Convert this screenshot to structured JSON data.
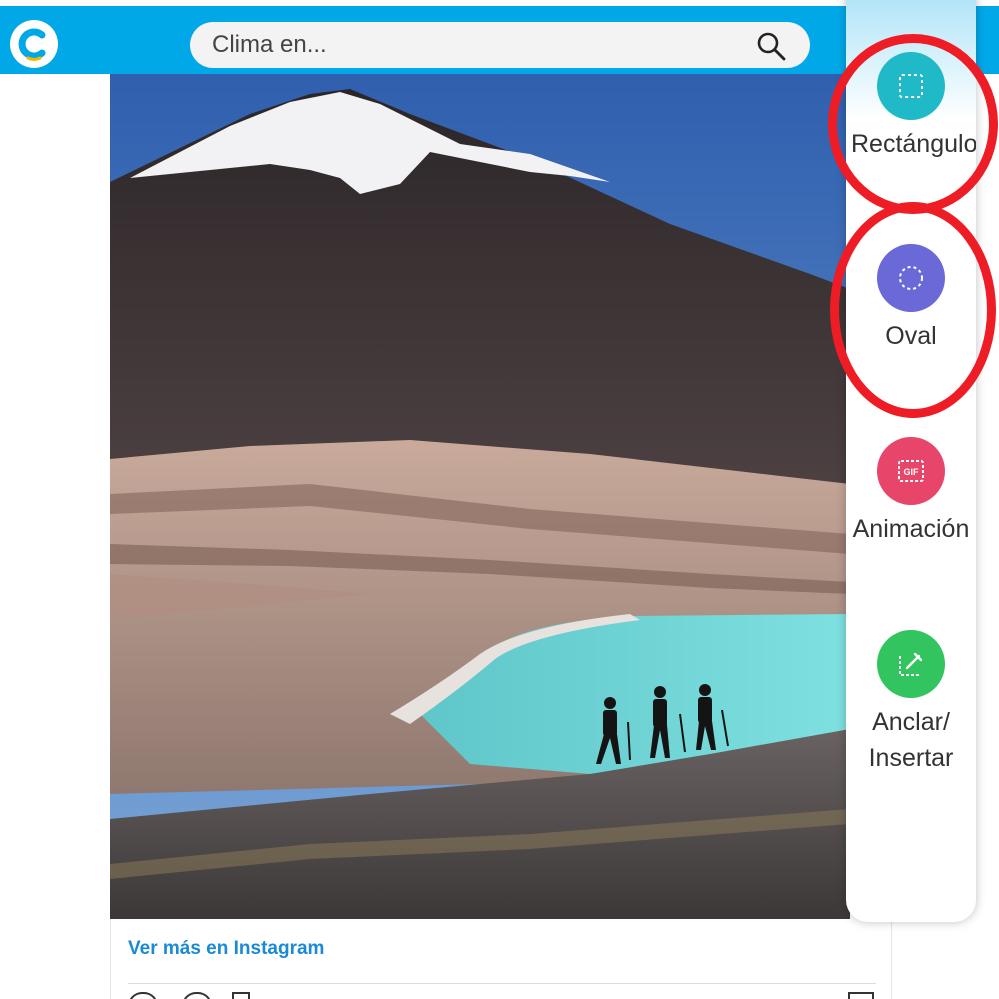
{
  "header": {
    "search": {
      "placeholder": "Clima en..."
    }
  },
  "post": {
    "instagram_link": "Ver más en Instagram"
  },
  "toolbar": {
    "tools": [
      {
        "label": "Rectángulo",
        "icon": "dashed-rectangle-icon",
        "color": "#1fb9c8"
      },
      {
        "label": "Oval",
        "icon": "dashed-circle-icon",
        "color": "#6b68d8"
      },
      {
        "label": "Animación",
        "icon": "gif-icon",
        "color": "#e8456b"
      },
      {
        "label": "Anclar/ Insertar",
        "icon": "pin-insert-icon",
        "color": "#32c45e"
      }
    ]
  },
  "colors": {
    "brand_blue": "#00a8e8",
    "highlight_red": "#ee1c25",
    "link_blue": "#1a8ad6"
  }
}
